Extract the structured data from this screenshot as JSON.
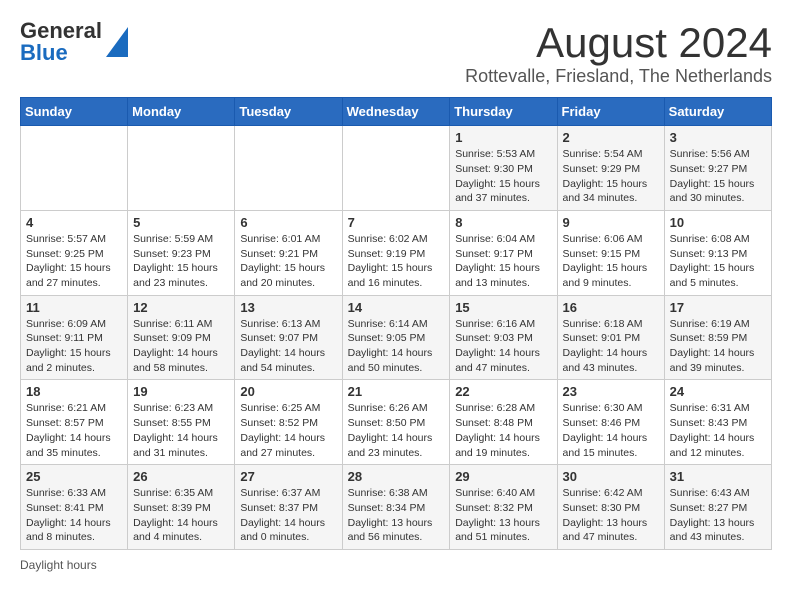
{
  "header": {
    "logo_general": "General",
    "logo_blue": "Blue",
    "title": "August 2024",
    "subtitle": "Rottevalle, Friesland, The Netherlands"
  },
  "weekdays": [
    "Sunday",
    "Monday",
    "Tuesday",
    "Wednesday",
    "Thursday",
    "Friday",
    "Saturday"
  ],
  "weeks": [
    [
      {
        "day": "",
        "info": ""
      },
      {
        "day": "",
        "info": ""
      },
      {
        "day": "",
        "info": ""
      },
      {
        "day": "",
        "info": ""
      },
      {
        "day": "1",
        "info": "Sunrise: 5:53 AM\nSunset: 9:30 PM\nDaylight: 15 hours and 37 minutes."
      },
      {
        "day": "2",
        "info": "Sunrise: 5:54 AM\nSunset: 9:29 PM\nDaylight: 15 hours and 34 minutes."
      },
      {
        "day": "3",
        "info": "Sunrise: 5:56 AM\nSunset: 9:27 PM\nDaylight: 15 hours and 30 minutes."
      }
    ],
    [
      {
        "day": "4",
        "info": "Sunrise: 5:57 AM\nSunset: 9:25 PM\nDaylight: 15 hours and 27 minutes."
      },
      {
        "day": "5",
        "info": "Sunrise: 5:59 AM\nSunset: 9:23 PM\nDaylight: 15 hours and 23 minutes."
      },
      {
        "day": "6",
        "info": "Sunrise: 6:01 AM\nSunset: 9:21 PM\nDaylight: 15 hours and 20 minutes."
      },
      {
        "day": "7",
        "info": "Sunrise: 6:02 AM\nSunset: 9:19 PM\nDaylight: 15 hours and 16 minutes."
      },
      {
        "day": "8",
        "info": "Sunrise: 6:04 AM\nSunset: 9:17 PM\nDaylight: 15 hours and 13 minutes."
      },
      {
        "day": "9",
        "info": "Sunrise: 6:06 AM\nSunset: 9:15 PM\nDaylight: 15 hours and 9 minutes."
      },
      {
        "day": "10",
        "info": "Sunrise: 6:08 AM\nSunset: 9:13 PM\nDaylight: 15 hours and 5 minutes."
      }
    ],
    [
      {
        "day": "11",
        "info": "Sunrise: 6:09 AM\nSunset: 9:11 PM\nDaylight: 15 hours and 2 minutes."
      },
      {
        "day": "12",
        "info": "Sunrise: 6:11 AM\nSunset: 9:09 PM\nDaylight: 14 hours and 58 minutes."
      },
      {
        "day": "13",
        "info": "Sunrise: 6:13 AM\nSunset: 9:07 PM\nDaylight: 14 hours and 54 minutes."
      },
      {
        "day": "14",
        "info": "Sunrise: 6:14 AM\nSunset: 9:05 PM\nDaylight: 14 hours and 50 minutes."
      },
      {
        "day": "15",
        "info": "Sunrise: 6:16 AM\nSunset: 9:03 PM\nDaylight: 14 hours and 47 minutes."
      },
      {
        "day": "16",
        "info": "Sunrise: 6:18 AM\nSunset: 9:01 PM\nDaylight: 14 hours and 43 minutes."
      },
      {
        "day": "17",
        "info": "Sunrise: 6:19 AM\nSunset: 8:59 PM\nDaylight: 14 hours and 39 minutes."
      }
    ],
    [
      {
        "day": "18",
        "info": "Sunrise: 6:21 AM\nSunset: 8:57 PM\nDaylight: 14 hours and 35 minutes."
      },
      {
        "day": "19",
        "info": "Sunrise: 6:23 AM\nSunset: 8:55 PM\nDaylight: 14 hours and 31 minutes."
      },
      {
        "day": "20",
        "info": "Sunrise: 6:25 AM\nSunset: 8:52 PM\nDaylight: 14 hours and 27 minutes."
      },
      {
        "day": "21",
        "info": "Sunrise: 6:26 AM\nSunset: 8:50 PM\nDaylight: 14 hours and 23 minutes."
      },
      {
        "day": "22",
        "info": "Sunrise: 6:28 AM\nSunset: 8:48 PM\nDaylight: 14 hours and 19 minutes."
      },
      {
        "day": "23",
        "info": "Sunrise: 6:30 AM\nSunset: 8:46 PM\nDaylight: 14 hours and 15 minutes."
      },
      {
        "day": "24",
        "info": "Sunrise: 6:31 AM\nSunset: 8:43 PM\nDaylight: 14 hours and 12 minutes."
      }
    ],
    [
      {
        "day": "25",
        "info": "Sunrise: 6:33 AM\nSunset: 8:41 PM\nDaylight: 14 hours and 8 minutes."
      },
      {
        "day": "26",
        "info": "Sunrise: 6:35 AM\nSunset: 8:39 PM\nDaylight: 14 hours and 4 minutes."
      },
      {
        "day": "27",
        "info": "Sunrise: 6:37 AM\nSunset: 8:37 PM\nDaylight: 14 hours and 0 minutes."
      },
      {
        "day": "28",
        "info": "Sunrise: 6:38 AM\nSunset: 8:34 PM\nDaylight: 13 hours and 56 minutes."
      },
      {
        "day": "29",
        "info": "Sunrise: 6:40 AM\nSunset: 8:32 PM\nDaylight: 13 hours and 51 minutes."
      },
      {
        "day": "30",
        "info": "Sunrise: 6:42 AM\nSunset: 8:30 PM\nDaylight: 13 hours and 47 minutes."
      },
      {
        "day": "31",
        "info": "Sunrise: 6:43 AM\nSunset: 8:27 PM\nDaylight: 13 hours and 43 minutes."
      }
    ]
  ],
  "footer": {
    "daylight_label": "Daylight hours"
  }
}
